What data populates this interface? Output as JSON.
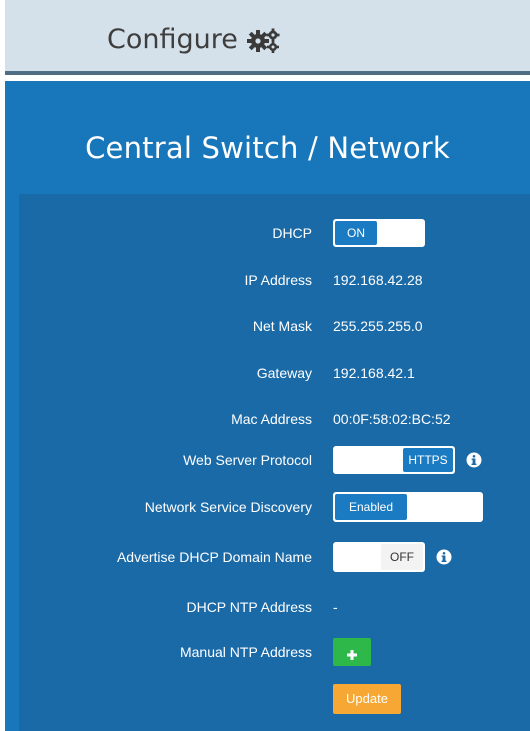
{
  "header": {
    "title": "Configure"
  },
  "panel": {
    "title": "Central Switch / Network"
  },
  "fields": {
    "dhcp": {
      "label": "DHCP",
      "state": "ON"
    },
    "ip_address": {
      "label": "IP Address",
      "value": "192.168.42.28"
    },
    "net_mask": {
      "label": "Net Mask",
      "value": "255.255.255.0"
    },
    "gateway": {
      "label": "Gateway",
      "value": "192.168.42.1"
    },
    "mac_address": {
      "label": "Mac Address",
      "value": "00:0F:58:02:BC:52"
    },
    "web_server_protocol": {
      "label": "Web Server Protocol",
      "state": "HTTPS"
    },
    "network_service_discovery": {
      "label": "Network Service Discovery",
      "state": "Enabled"
    },
    "advertise_dhcp_domain_name": {
      "label": "Advertise DHCP Domain Name",
      "state": "OFF"
    },
    "dhcp_ntp_address": {
      "label": "DHCP NTP Address",
      "value": "-"
    },
    "manual_ntp_address": {
      "label": "Manual NTP Address"
    }
  },
  "actions": {
    "update_label": "Update"
  },
  "colors": {
    "header_bg": "#d4e0ea",
    "panel_bg": "#1877ba",
    "inner_bg": "#1a6aa8",
    "toggle_on": "#1b7bc2",
    "add_button": "#2eb84a",
    "update_button": "#f7a733"
  }
}
